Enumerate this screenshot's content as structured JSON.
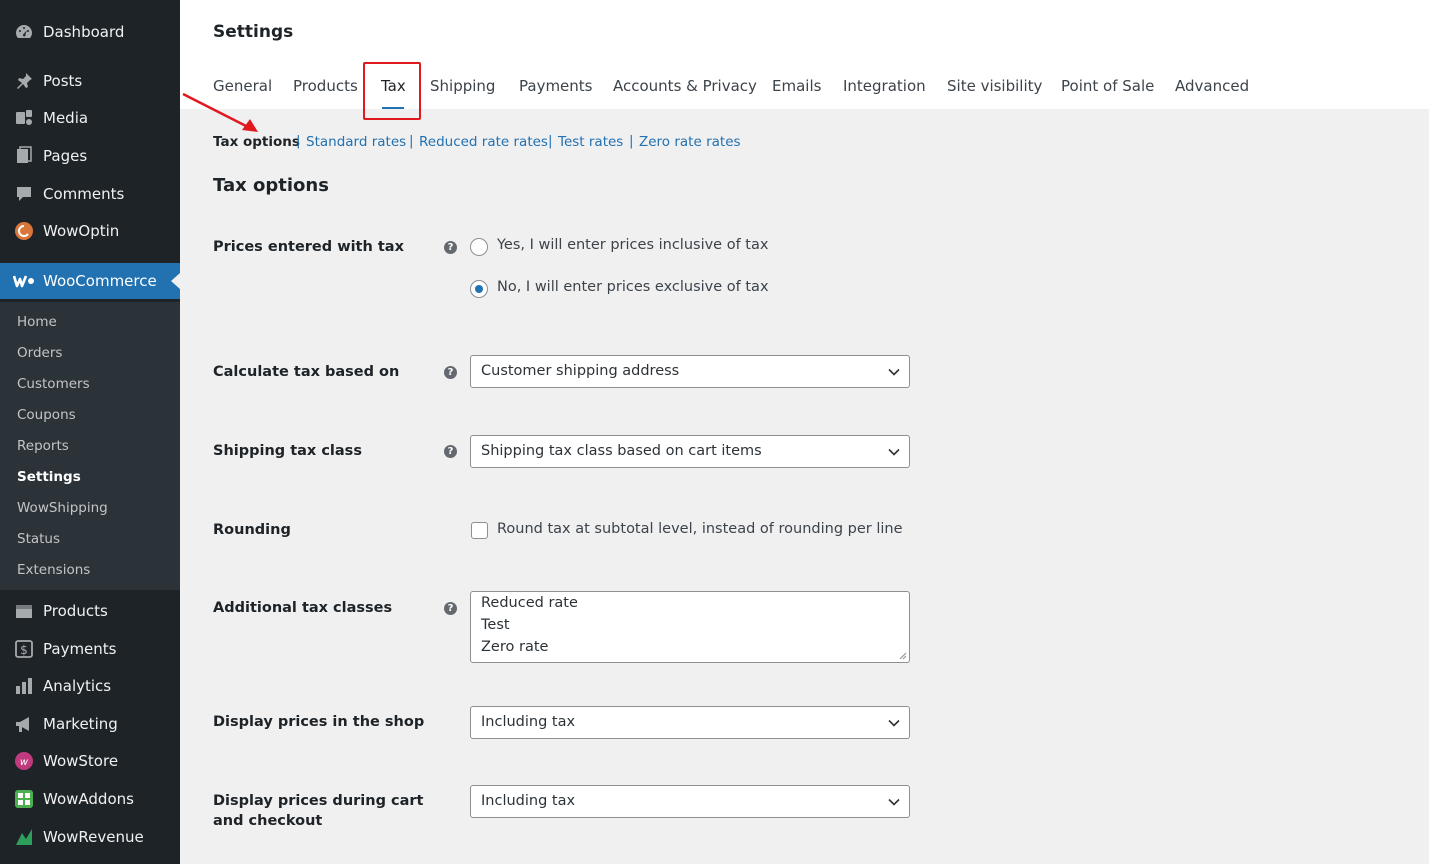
{
  "sidebar": {
    "top_items": [
      {
        "label": "Dashboard",
        "icon": "dashboard-icon"
      },
      {
        "label": "Posts",
        "icon": "pin-icon"
      },
      {
        "label": "Media",
        "icon": "media-icon"
      },
      {
        "label": "Pages",
        "icon": "pages-icon"
      },
      {
        "label": "Comments",
        "icon": "comment-icon"
      },
      {
        "label": "WowOptin",
        "icon": "wowoptin-icon"
      }
    ],
    "woocommerce": {
      "label": "WooCommerce",
      "icon": "woocommerce-icon"
    },
    "submenu": [
      "Home",
      "Orders",
      "Customers",
      "Coupons",
      "Reports",
      "Settings",
      "WowShipping",
      "Status",
      "Extensions"
    ],
    "bottom_items": [
      {
        "label": "Products",
        "icon": "products-icon"
      },
      {
        "label": "Payments",
        "icon": "payments-icon"
      },
      {
        "label": "Analytics",
        "icon": "analytics-icon"
      },
      {
        "label": "Marketing",
        "icon": "megaphone-icon"
      },
      {
        "label": "WowStore",
        "icon": "wowstore-icon"
      },
      {
        "label": "WowAddons",
        "icon": "wowaddons-icon"
      },
      {
        "label": "WowRevenue",
        "icon": "wowrevenue-icon"
      }
    ]
  },
  "header": {
    "title": "Settings",
    "tabs": [
      "General",
      "Products",
      "Tax",
      "Shipping",
      "Payments",
      "Accounts & Privacy",
      "Emails",
      "Integration",
      "Site visibility",
      "Point of Sale",
      "Advanced"
    ],
    "active_tab": "Tax"
  },
  "subnav": [
    "Tax options",
    "Standard rates",
    "Reduced rate rates",
    "Test rates",
    "Zero rate rates"
  ],
  "section_title": "Tax options",
  "fields": {
    "prices_entered": {
      "label": "Prices entered with tax",
      "options": [
        "Yes, I will enter prices inclusive of tax",
        "No, I will enter prices exclusive of tax"
      ],
      "selected": "No, I will enter prices exclusive of tax"
    },
    "calc_based_on": {
      "label": "Calculate tax based on",
      "value": "Customer shipping address"
    },
    "shipping_tax_class": {
      "label": "Shipping tax class",
      "value": "Shipping tax class based on cart items"
    },
    "rounding": {
      "label": "Rounding",
      "checkbox_label": "Round tax at subtotal level, instead of rounding per line",
      "checked": false
    },
    "additional_classes": {
      "label": "Additional tax classes",
      "lines": [
        "Reduced rate",
        "Test",
        "Zero rate"
      ]
    },
    "display_shop": {
      "label": "Display prices in the shop",
      "value": "Including tax"
    },
    "display_cart": {
      "label": "Display prices during cart and checkout",
      "value": "Including tax"
    }
  },
  "colors": {
    "sidebar_bg": "#1d2327",
    "accent": "#2271b1",
    "highlight_red": "#e0191f"
  }
}
